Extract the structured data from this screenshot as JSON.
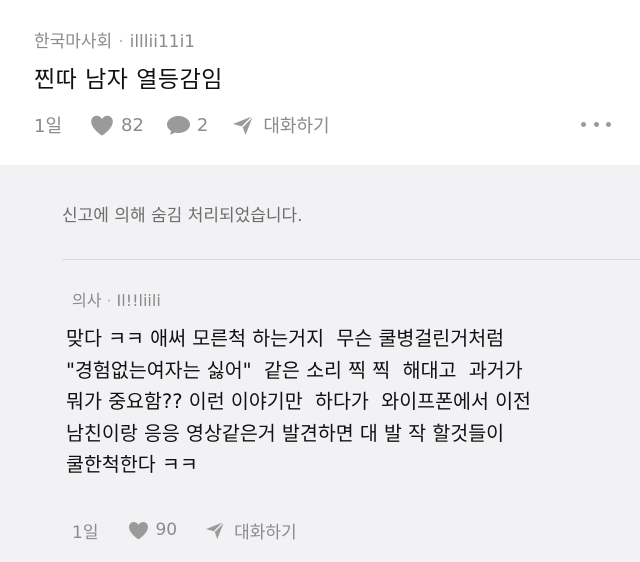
{
  "post": {
    "board": "한국마사회",
    "separator": "·",
    "author": "illlii11i1",
    "title": "찐따 남자 열등감임",
    "time": "1일",
    "likes": "82",
    "comments": "2",
    "dm_label": "대화하기",
    "icons": {
      "like": "heart-icon",
      "comment": "speech-bubble-icon",
      "dm": "paper-plane-icon",
      "more": "more-horizontal-icon"
    }
  },
  "replies": {
    "hidden_notice": "신고에 의해 숨김 처리되었습니다.",
    "reply": {
      "board": "의사",
      "separator": "·",
      "author": "Il!!liili",
      "lines": [
        "맞다 ㅋㅋ 애써 모른척 하는거지  무슨 쿨병걸린거처럼",
        "\"경험없는여자는 싫어\"  같은 소리 찍 찍  해대고  과거가",
        "뭐가 중요함?? 이런 이야기만  하다가  와이프폰에서 이전",
        "남친이랑 응응 영상같은거 발견하면 대 발 작 할것들이",
        "쿨한척한다 ㅋㅋ"
      ],
      "time": "1일",
      "likes": "90",
      "dm_label": "대화하기"
    }
  },
  "colors": {
    "background": "#ffffff",
    "reply_background": "#f2f2f4",
    "meta_text": "#8b8b8b",
    "icon": "#9a9a9a",
    "body_text": "#111111"
  }
}
